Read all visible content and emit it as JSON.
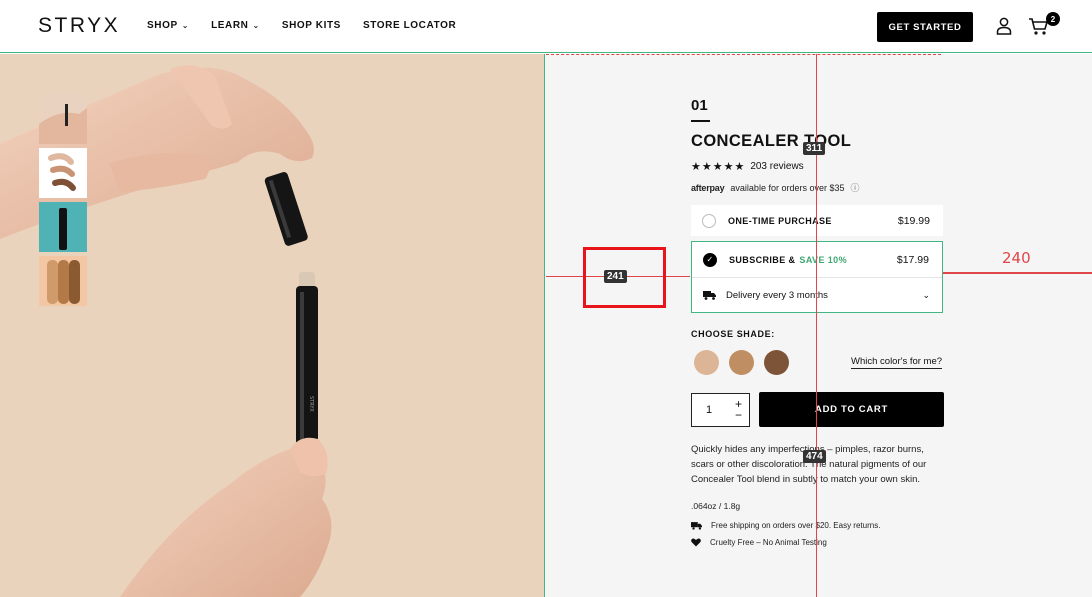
{
  "header": {
    "logo": "STRYX",
    "nav": [
      {
        "label": "SHOP",
        "has_dropdown": true
      },
      {
        "label": "LEARN",
        "has_dropdown": true
      },
      {
        "label": "SHOP KITS",
        "has_dropdown": false
      },
      {
        "label": "STORE LOCATOR",
        "has_dropdown": false
      }
    ],
    "cta_label": "GET STARTED",
    "cart_count": "2",
    "icons": [
      "user-icon",
      "cart-icon"
    ]
  },
  "gallery": {
    "thumbnails": [
      "hand-with-tool-thumb",
      "swatches-thumb",
      "tool-teal-thumb",
      "shade-strokes-thumb"
    ],
    "colors": {
      "bg": "#ead3bd",
      "thumb_teal": "#4fb3b5"
    }
  },
  "product": {
    "number": "01",
    "title": "CONCEALER TOOL",
    "stars": "★★★★★",
    "reviews": "203 reviews",
    "afterpay_logo": "afterpay",
    "afterpay_text": "available for orders over $35",
    "one_time_label": "ONE-TIME PURCHASE",
    "one_time_price": "$19.99",
    "subscribe_label": "SUBSCRIBE &",
    "subscribe_save": "SAVE 10%",
    "subscribe_price": "$17.99",
    "delivery_label": "Delivery every 3 months",
    "shade_label": "CHOOSE SHADE:",
    "shades": [
      "#dcb597",
      "#c08e63",
      "#7d5438"
    ],
    "which_color": "Which color's for me?",
    "quantity": "1",
    "qty_plus": "+",
    "qty_minus": "−",
    "add_to_cart": "ADD TO CART",
    "description": "Quickly hides any imperfections – pimples, razor burns, scars or other discoloration. The natural pigments of our Concealer Tool blend in subtly to match your own skin.",
    "weight": ".064oz / 1.8g",
    "features": [
      {
        "icon": "truck-icon",
        "text": "Free shipping on orders over $20. Easy returns."
      },
      {
        "icon": "heart-icon",
        "text": "Cruelty Free – No Animal Testing"
      }
    ],
    "accent_color": "#41b883"
  },
  "overlay": {
    "tag_241": "241",
    "tag_311": "311",
    "tag_474": "474",
    "label_240": "240",
    "color": "#e0454a"
  }
}
